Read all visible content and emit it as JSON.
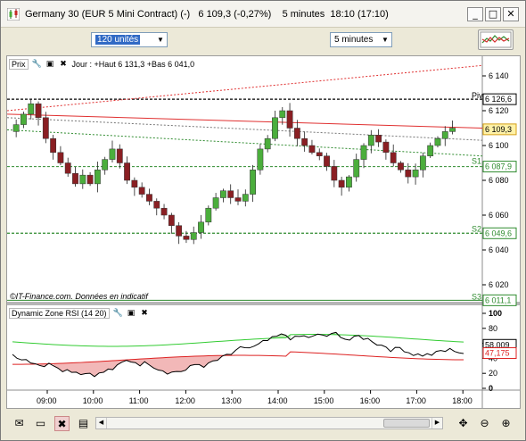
{
  "window": {
    "title": "Germany 30 (EUR 5 Mini Contract) (-)",
    "price": "6 109,3 (-0,27%)",
    "timeframe": "5 minutes",
    "time": "18:10 (17:10)"
  },
  "toolbar": {
    "units_value": "120 unités",
    "timeframe_value": "5 minutes"
  },
  "price_panel": {
    "label": "Prix",
    "info": "Jour : +Haut 6 131,3 +Bas 6 041,0",
    "watermark": "©IT-Finance.com. Données en indicatif",
    "levels": {
      "piv_label": "Piv",
      "piv_value": "6 126,6",
      "last_value": "6 109,3",
      "s1_label": "S1",
      "s1_value": "6 087,9",
      "s2_label": "S2",
      "s2_value": "6 049,6",
      "s3_label": "S3",
      "s3_value": "6 011,1"
    },
    "y_ticks": [
      "6 140",
      "6 120",
      "6 100",
      "6 080",
      "6 060",
      "6 040",
      "6 020"
    ]
  },
  "rsi_panel": {
    "label": "Dynamic Zone RSI (14 20)",
    "value1": "58,009",
    "value2": "47,175",
    "y_ticks": [
      "100",
      "80",
      "60",
      "40",
      "20",
      "0"
    ]
  },
  "x_ticks": [
    "09:00",
    "10:00",
    "11:00",
    "12:00",
    "13:00",
    "14:00",
    "15:00",
    "16:00",
    "17:00",
    "18:00"
  ],
  "colors": {
    "up": "#4bae3c",
    "down": "#8a1f23",
    "pivot": "#000000",
    "support": "#2e8b2e",
    "resistance_line": "#e03030",
    "rsi": "#000000",
    "rsi_upper": "#33cc33",
    "rsi_lower": "#dd2222"
  },
  "icons": {
    "app": "candlestick-chart-icon",
    "minimize": "minimize-icon",
    "maximize": "maximize-icon",
    "close": "close-icon",
    "indicator": "indicator-chart-icon",
    "email": "email-icon",
    "window": "window-icon",
    "delete": "delete-chart-icon",
    "print": "print-icon",
    "pan": "pan-arrows-icon",
    "zoom_out": "zoom-out-icon",
    "zoom_in": "zoom-in-icon"
  }
}
